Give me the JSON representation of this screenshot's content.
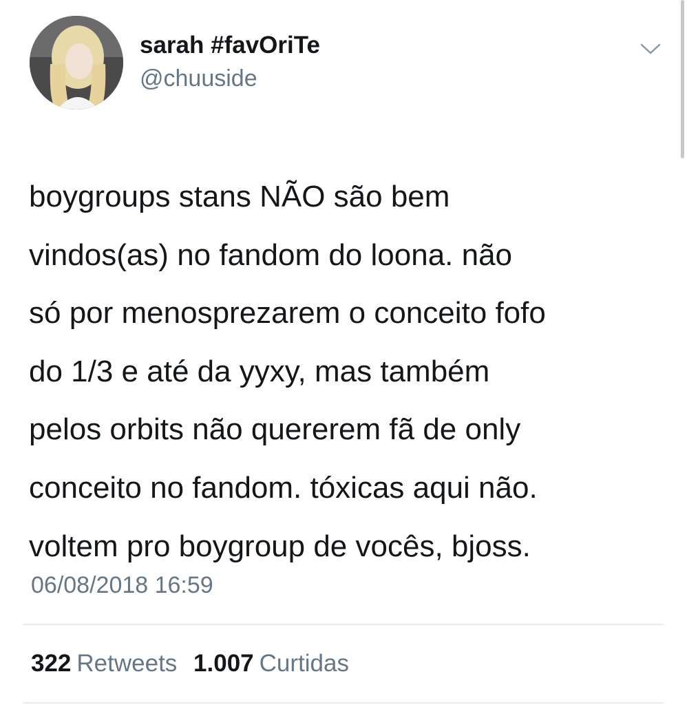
{
  "tweet": {
    "author": {
      "display_name": "sarah #favOriTe",
      "handle": "@chuuside",
      "avatar_icon": "user-avatar"
    },
    "menu_icon": "chevron-down-icon",
    "text_lines": [
      "boygroups stans NÃO são bem",
      "vindos(as) no fandom do loona. não",
      "só por menosprezarem o conceito fofo",
      "do 1/3 e até da yyxy, mas também",
      "pelos orbits não quererem fã de only",
      "conceito no fandom. tóxicas aqui não.",
      "voltem pro boygroup de vocês, bjoss."
    ],
    "timestamp": "06/08/2018 16:59",
    "stats": {
      "retweets_count": "322",
      "retweets_label": "Retweets",
      "likes_count": "1.007",
      "likes_label": "Curtidas"
    }
  },
  "colors": {
    "text": "#14171a",
    "secondary": "#657786",
    "divider": "#e6ecf0"
  }
}
